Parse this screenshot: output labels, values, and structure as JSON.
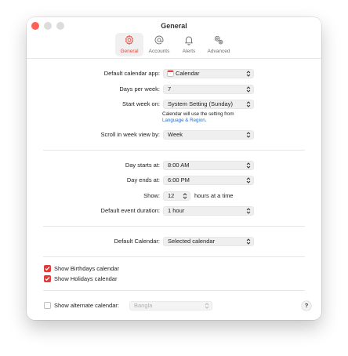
{
  "window": {
    "title": "General"
  },
  "toolbar": {
    "tabs": [
      {
        "label": "General",
        "icon": "gear-icon",
        "active": true
      },
      {
        "label": "Accounts",
        "icon": "at-icon",
        "active": false
      },
      {
        "label": "Alerts",
        "icon": "bell-icon",
        "active": false
      },
      {
        "label": "Advanced",
        "icon": "gears-icon",
        "active": false
      }
    ]
  },
  "settings": {
    "default_app": {
      "label": "Default calendar app:",
      "value": "Calendar"
    },
    "days_per_week": {
      "label": "Days per week:",
      "value": "7"
    },
    "start_week": {
      "label": "Start week on:",
      "value": "System Setting (Sunday)",
      "note_line1": "Calendar will use the setting from",
      "note_link": "Language & Region",
      "note_end": "."
    },
    "scroll_week": {
      "label": "Scroll in week view by:",
      "value": "Week"
    },
    "day_starts": {
      "label": "Day starts at:",
      "value": "8:00 AM"
    },
    "day_ends": {
      "label": "Day ends at:",
      "value": "6:00 PM"
    },
    "show": {
      "label": "Show:",
      "value": "12",
      "suffix": "hours at a time"
    },
    "default_duration": {
      "label": "Default event duration:",
      "value": "1 hour"
    },
    "default_calendar": {
      "label": "Default Calendar:",
      "value": "Selected calendar"
    },
    "show_birthdays": {
      "label": "Show Birthdays calendar",
      "checked": true
    },
    "show_holidays": {
      "label": "Show Holidays calendar",
      "checked": true
    },
    "alternate": {
      "label": "Show alternate calendar:",
      "value": "Bangla",
      "checked": false
    }
  },
  "help": {
    "label": "?"
  },
  "colors": {
    "accent": "#e0483e",
    "link": "#2a6ecf",
    "checkbox": "#e23b3b"
  }
}
